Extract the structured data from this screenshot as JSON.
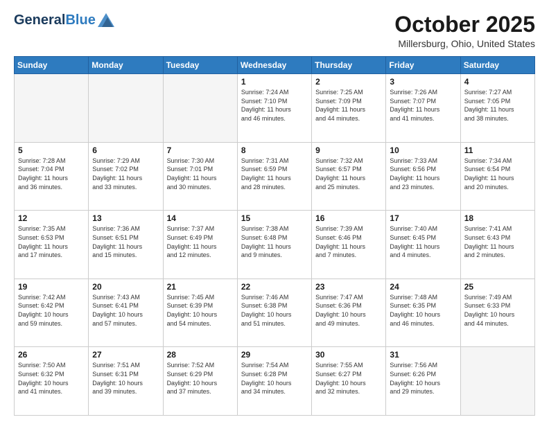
{
  "header": {
    "logo_general": "General",
    "logo_blue": "Blue",
    "month": "October 2025",
    "location": "Millersburg, Ohio, United States"
  },
  "days_of_week": [
    "Sunday",
    "Monday",
    "Tuesday",
    "Wednesday",
    "Thursday",
    "Friday",
    "Saturday"
  ],
  "weeks": [
    [
      {
        "day": "",
        "info": ""
      },
      {
        "day": "",
        "info": ""
      },
      {
        "day": "",
        "info": ""
      },
      {
        "day": "1",
        "info": "Sunrise: 7:24 AM\nSunset: 7:10 PM\nDaylight: 11 hours\nand 46 minutes."
      },
      {
        "day": "2",
        "info": "Sunrise: 7:25 AM\nSunset: 7:09 PM\nDaylight: 11 hours\nand 44 minutes."
      },
      {
        "day": "3",
        "info": "Sunrise: 7:26 AM\nSunset: 7:07 PM\nDaylight: 11 hours\nand 41 minutes."
      },
      {
        "day": "4",
        "info": "Sunrise: 7:27 AM\nSunset: 7:05 PM\nDaylight: 11 hours\nand 38 minutes."
      }
    ],
    [
      {
        "day": "5",
        "info": "Sunrise: 7:28 AM\nSunset: 7:04 PM\nDaylight: 11 hours\nand 36 minutes."
      },
      {
        "day": "6",
        "info": "Sunrise: 7:29 AM\nSunset: 7:02 PM\nDaylight: 11 hours\nand 33 minutes."
      },
      {
        "day": "7",
        "info": "Sunrise: 7:30 AM\nSunset: 7:01 PM\nDaylight: 11 hours\nand 30 minutes."
      },
      {
        "day": "8",
        "info": "Sunrise: 7:31 AM\nSunset: 6:59 PM\nDaylight: 11 hours\nand 28 minutes."
      },
      {
        "day": "9",
        "info": "Sunrise: 7:32 AM\nSunset: 6:57 PM\nDaylight: 11 hours\nand 25 minutes."
      },
      {
        "day": "10",
        "info": "Sunrise: 7:33 AM\nSunset: 6:56 PM\nDaylight: 11 hours\nand 23 minutes."
      },
      {
        "day": "11",
        "info": "Sunrise: 7:34 AM\nSunset: 6:54 PM\nDaylight: 11 hours\nand 20 minutes."
      }
    ],
    [
      {
        "day": "12",
        "info": "Sunrise: 7:35 AM\nSunset: 6:53 PM\nDaylight: 11 hours\nand 17 minutes."
      },
      {
        "day": "13",
        "info": "Sunrise: 7:36 AM\nSunset: 6:51 PM\nDaylight: 11 hours\nand 15 minutes."
      },
      {
        "day": "14",
        "info": "Sunrise: 7:37 AM\nSunset: 6:49 PM\nDaylight: 11 hours\nand 12 minutes."
      },
      {
        "day": "15",
        "info": "Sunrise: 7:38 AM\nSunset: 6:48 PM\nDaylight: 11 hours\nand 9 minutes."
      },
      {
        "day": "16",
        "info": "Sunrise: 7:39 AM\nSunset: 6:46 PM\nDaylight: 11 hours\nand 7 minutes."
      },
      {
        "day": "17",
        "info": "Sunrise: 7:40 AM\nSunset: 6:45 PM\nDaylight: 11 hours\nand 4 minutes."
      },
      {
        "day": "18",
        "info": "Sunrise: 7:41 AM\nSunset: 6:43 PM\nDaylight: 11 hours\nand 2 minutes."
      }
    ],
    [
      {
        "day": "19",
        "info": "Sunrise: 7:42 AM\nSunset: 6:42 PM\nDaylight: 10 hours\nand 59 minutes."
      },
      {
        "day": "20",
        "info": "Sunrise: 7:43 AM\nSunset: 6:41 PM\nDaylight: 10 hours\nand 57 minutes."
      },
      {
        "day": "21",
        "info": "Sunrise: 7:45 AM\nSunset: 6:39 PM\nDaylight: 10 hours\nand 54 minutes."
      },
      {
        "day": "22",
        "info": "Sunrise: 7:46 AM\nSunset: 6:38 PM\nDaylight: 10 hours\nand 51 minutes."
      },
      {
        "day": "23",
        "info": "Sunrise: 7:47 AM\nSunset: 6:36 PM\nDaylight: 10 hours\nand 49 minutes."
      },
      {
        "day": "24",
        "info": "Sunrise: 7:48 AM\nSunset: 6:35 PM\nDaylight: 10 hours\nand 46 minutes."
      },
      {
        "day": "25",
        "info": "Sunrise: 7:49 AM\nSunset: 6:33 PM\nDaylight: 10 hours\nand 44 minutes."
      }
    ],
    [
      {
        "day": "26",
        "info": "Sunrise: 7:50 AM\nSunset: 6:32 PM\nDaylight: 10 hours\nand 41 minutes."
      },
      {
        "day": "27",
        "info": "Sunrise: 7:51 AM\nSunset: 6:31 PM\nDaylight: 10 hours\nand 39 minutes."
      },
      {
        "day": "28",
        "info": "Sunrise: 7:52 AM\nSunset: 6:29 PM\nDaylight: 10 hours\nand 37 minutes."
      },
      {
        "day": "29",
        "info": "Sunrise: 7:54 AM\nSunset: 6:28 PM\nDaylight: 10 hours\nand 34 minutes."
      },
      {
        "day": "30",
        "info": "Sunrise: 7:55 AM\nSunset: 6:27 PM\nDaylight: 10 hours\nand 32 minutes."
      },
      {
        "day": "31",
        "info": "Sunrise: 7:56 AM\nSunset: 6:26 PM\nDaylight: 10 hours\nand 29 minutes."
      },
      {
        "day": "",
        "info": ""
      }
    ]
  ]
}
